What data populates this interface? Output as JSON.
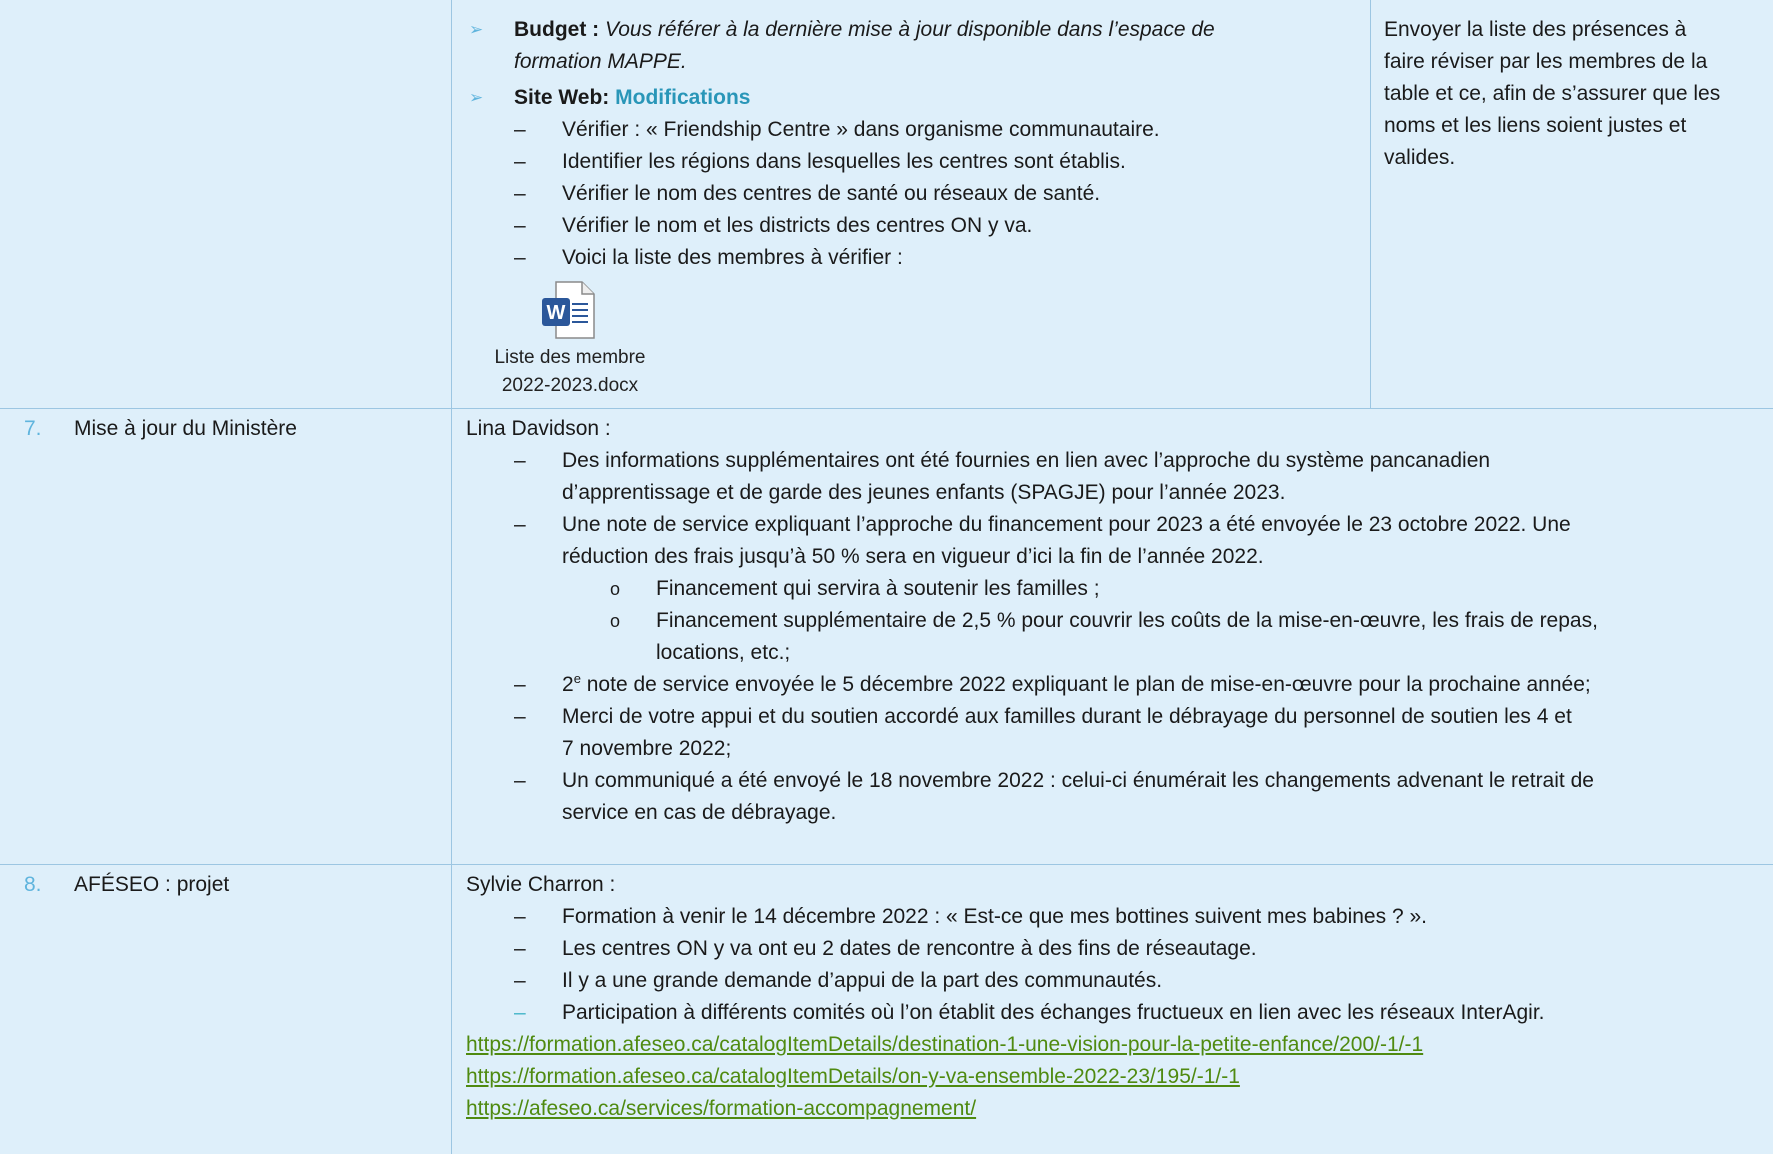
{
  "row_top": {
    "budget_label": "Budget :",
    "budget_text_1": "Vous référer à la dernière mise à jour disponible dans l’espace de",
    "budget_text_2": "formation MAPPE.",
    "site_label": "Site Web:",
    "site_value": "Modifications",
    "items": [
      "Vérifier : « Friendship Centre » dans organisme communautaire.",
      "Identifier les régions dans lesquelles les centres sont établis.",
      "Vérifier le nom des centres de santé ou réseaux de santé.",
      "Vérifier le nom et les districts des centres ON y va.",
      "Voici la liste des membres à vérifier :"
    ],
    "attachment_line1": "Liste des membre",
    "attachment_line2": "2022-2023.docx",
    "attachment_icon": "word-document-icon",
    "right_col": [
      "Envoyer la liste des présences à",
      "faire réviser par les membres de la",
      "table et ce, afin de s’assurer que les",
      "noms et les liens soient justes et",
      "valides."
    ]
  },
  "row7": {
    "number": "7.",
    "topic": "Mise à jour du Ministère",
    "presenter": "Lina Davidson :",
    "b1_l1": "Des informations supplémentaires ont été fournies en lien avec l’approche du système pancanadien",
    "b1_l2": "d’apprentissage et de garde des jeunes enfants (SPAGJE) pour l’année 2023.",
    "b2_l1": "Une note de service expliquant l’approche du financement pour 2023 a été envoyée le 23 octobre 2022. Une",
    "b2_l2": "réduction des frais jusqu’à 50 % sera en vigueur d’ici la fin de l’année 2022.",
    "sub1": "Financement qui servira à soutenir les familles ;",
    "sub2_l1": "Financement supplémentaire de 2,5 % pour couvrir les coûts de la mise-en-œuvre, les frais de repas,",
    "sub2_l2": "locations, etc.;",
    "b3_num": "2",
    "b3_sup": "e",
    "b3_rest": " note de service envoyée le 5 décembre 2022 expliquant le plan de mise-en-œuvre pour la prochaine année;",
    "b4_l1": "Merci de votre appui et du soutien accordé aux familles durant le débrayage du personnel de soutien les 4 et",
    "b4_l2": "7 novembre 2022;",
    "b5_l1": "Un communiqué a été envoyé le 18 novembre 2022 : celui-ci énumérait les changements advenant le retrait de",
    "b5_l2": "service en cas de débrayage."
  },
  "row8": {
    "number": "8.",
    "topic": "AFÉSEO : projet",
    "presenter": "Sylvie Charron :",
    "items": [
      "Formation à venir le 14 décembre 2022 : « Est-ce que mes bottines suivent mes babines ? ».",
      "Les centres ON y va ont eu 2 dates de rencontre à des fins de réseautage.",
      "Il y a une grande demande d’appui de la part des communautés.",
      "Participation à différents comités où l’on établit des échanges fructueux en lien avec les réseaux InterAgir."
    ],
    "links": [
      "https://formation.afeseo.ca/catalogItemDetails/destination-1-une-vision-pour-la-petite-enfance/200/-1/-1",
      "https://formation.afeseo.ca/catalogItemDetails/on-y-va-ensemble-2022-23/195/-1/-1",
      "https://afeseo.ca/services/formation-accompagnement/"
    ]
  },
  "colors": {
    "row_bg": "#deeffa",
    "border": "#9cc6e2",
    "number": "#5fb4dd",
    "heading_teal": "#2996b8",
    "link": "#4f8a10"
  }
}
